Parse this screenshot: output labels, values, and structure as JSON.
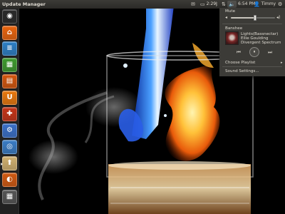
{
  "panel": {
    "window_title": "Update Manager",
    "time": "6:54 PM",
    "user": "Timmy",
    "battery_time": "2:29"
  },
  "launcher": {
    "items": [
      {
        "name": "dash-home",
        "icon": "ubuntu-logo-icon",
        "glyph": "◉",
        "color": "#2a2a2a",
        "running": false
      },
      {
        "name": "home-folder",
        "icon": "folder-icon",
        "glyph": "⌂",
        "color": "#e8640e",
        "running": false
      },
      {
        "name": "libreoffice-writer",
        "icon": "writer-icon",
        "glyph": "≡",
        "color": "#2d7fc4",
        "running": false
      },
      {
        "name": "libreoffice-calc",
        "icon": "calc-icon",
        "glyph": "▦",
        "color": "#3e9a2e",
        "running": false
      },
      {
        "name": "libreoffice-impress",
        "icon": "impress-icon",
        "glyph": "▤",
        "color": "#d3560e",
        "running": false
      },
      {
        "name": "ubuntu-software-center",
        "icon": "software-center-icon",
        "glyph": "U",
        "color": "#e8780e",
        "running": false
      },
      {
        "name": "ubuntu-one",
        "icon": "ubuntu-one-icon",
        "glyph": "✚",
        "color": "#c43418",
        "running": false
      },
      {
        "name": "system-settings",
        "icon": "settings-icon",
        "glyph": "⚙",
        "color": "#3a70c8",
        "running": false
      },
      {
        "name": "chromium-browser",
        "icon": "chromium-icon",
        "glyph": "◎",
        "color": "#3a7cc4",
        "running": false
      },
      {
        "name": "update-manager",
        "icon": "update-manager-icon",
        "glyph": "⬆",
        "color": "#d0b070",
        "running": true
      },
      {
        "name": "firefox",
        "icon": "firefox-icon",
        "glyph": "◐",
        "color": "#d05a12",
        "running": false
      },
      {
        "name": "workspace-switcher",
        "icon": "workspace-switcher-icon",
        "glyph": "▦",
        "color": "#555555",
        "running": false
      }
    ]
  },
  "sound_menu": {
    "mute_label": "Mute",
    "volume_level": 0.55,
    "player_name": "Banshee",
    "song_title": "Lights(Bassnectar)",
    "song_artist": "Ellie Goulding",
    "song_album": "Divergent Spectrum",
    "prev_glyph": "⏮",
    "play_glyph": "⏸",
    "next_glyph": "⏭",
    "choose_playlist_label": "Choose Playlist",
    "submenu_arrow": "▸",
    "settings_label": "Sound Settings..."
  },
  "colors": {
    "panel_bg": "#3c3b37",
    "panel_text": "#dfdbd2",
    "menu_bg": "#3c3b37"
  }
}
